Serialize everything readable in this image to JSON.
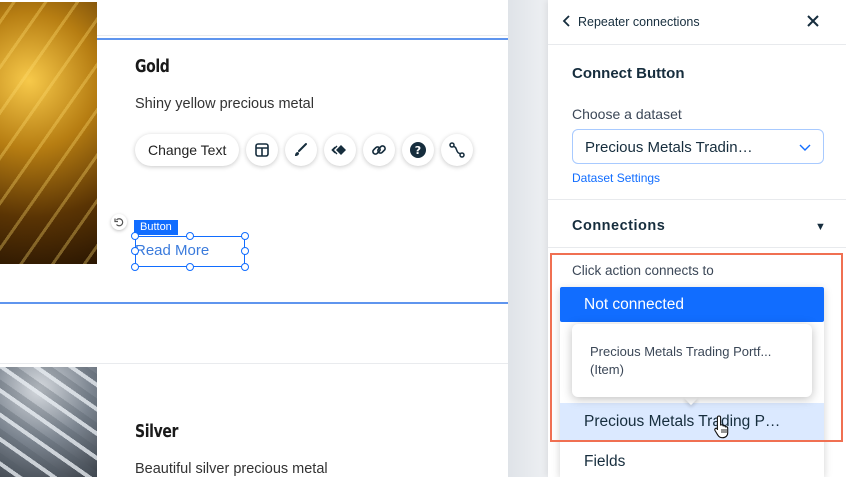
{
  "canvas": {
    "items": [
      {
        "title": "Gold",
        "description": "Shiny yellow precious metal",
        "button_tag": "Button",
        "button_label": "Read More"
      },
      {
        "title": "Silver",
        "description": "Beautiful silver precious metal"
      }
    ],
    "toolbar": {
      "change_text_label": "Change Text",
      "icons": [
        "layout-icon",
        "design-brush-icon",
        "animation-icon",
        "link-icon",
        "help-icon",
        "connect-data-icon"
      ]
    }
  },
  "panel": {
    "header_title": "Repeater connections",
    "section_title": "Connect Button",
    "choose_label": "Choose a dataset",
    "dataset_value": "Precious Metals Tradin…",
    "dataset_settings_link": "Dataset Settings",
    "connections_title": "Connections",
    "connections_toggle": "▼",
    "click_action_label": "Click action connects to",
    "dropdown": {
      "selected": "Not connected",
      "tooltip_line1": "Precious Metals Trading Portf...",
      "tooltip_line2": "(Item)",
      "hovered": "Precious Metals Trading P…",
      "fields": "Fields"
    }
  },
  "colors": {
    "accent": "#116dff",
    "highlight_border": "#f07052",
    "selection_border": "#5f95ee",
    "hover_bg": "#dbe9ff"
  }
}
